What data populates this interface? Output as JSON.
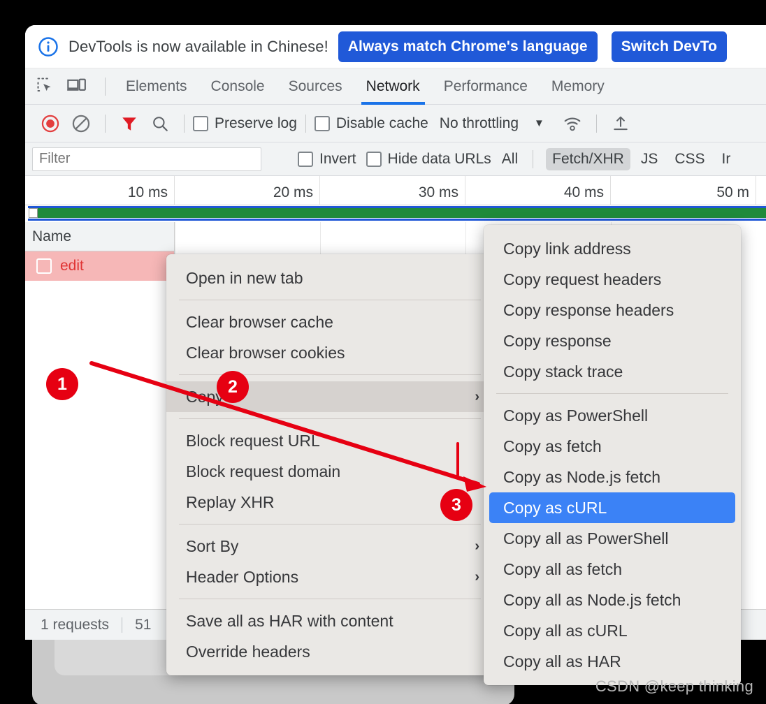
{
  "banner": {
    "icon": "info-circle-icon",
    "message": "DevTools is now available in Chinese!",
    "primary_button": "Always match Chrome's language",
    "secondary_button": "Switch DevTo"
  },
  "tabs": {
    "inspect_icon": "inspect-element-icon",
    "device_icon": "device-toolbar-icon",
    "items": [
      {
        "label": "Elements",
        "active": false
      },
      {
        "label": "Console",
        "active": false
      },
      {
        "label": "Sources",
        "active": false
      },
      {
        "label": "Network",
        "active": true
      },
      {
        "label": "Performance",
        "active": false
      },
      {
        "label": "Memory",
        "active": false
      }
    ]
  },
  "toolbar": {
    "record_icon": "record-icon",
    "clear_icon": "clear-icon",
    "filter_icon": "filter-icon",
    "search_icon": "search-icon",
    "preserve_log": "Preserve log",
    "disable_cache": "Disable cache",
    "throttling": "No throttling",
    "throttle_caret": "chevron-down-icon",
    "wifi_icon": "network-conditions-icon",
    "import_icon": "import-har-icon"
  },
  "filter": {
    "placeholder": "Filter",
    "value": "",
    "invert": "Invert",
    "hide_data_urls": "Hide data URLs",
    "types": [
      {
        "label": "All",
        "selected": false
      },
      {
        "label": "Fetch/XHR",
        "selected": true
      },
      {
        "label": "JS",
        "selected": false
      },
      {
        "label": "CSS",
        "selected": false
      },
      {
        "label": "Ir",
        "selected": false
      }
    ]
  },
  "timeline": {
    "ticks": [
      "10 ms",
      "20 ms",
      "30 ms",
      "40 ms",
      "50 m"
    ]
  },
  "requests": {
    "column_header": "Name",
    "rows": [
      {
        "name": "edit",
        "error": true
      }
    ]
  },
  "status": {
    "requests": "1 requests",
    "transferred": "51"
  },
  "context_menu": {
    "items": [
      {
        "label": "Open in new tab",
        "type": "item"
      },
      {
        "type": "separator"
      },
      {
        "label": "Clear browser cache",
        "type": "item"
      },
      {
        "label": "Clear browser cookies",
        "type": "item"
      },
      {
        "type": "separator"
      },
      {
        "label": "Copy",
        "type": "submenu",
        "hover": true,
        "arrow": "›"
      },
      {
        "type": "separator"
      },
      {
        "label": "Block request URL",
        "type": "item"
      },
      {
        "label": "Block request domain",
        "type": "item"
      },
      {
        "label": "Replay XHR",
        "type": "item"
      },
      {
        "type": "separator"
      },
      {
        "label": "Sort By",
        "type": "submenu",
        "arrow": "›"
      },
      {
        "label": "Header Options",
        "type": "submenu",
        "arrow": "›"
      },
      {
        "type": "separator"
      },
      {
        "label": "Save all as HAR with content",
        "type": "item"
      },
      {
        "label": "Override headers",
        "type": "item"
      }
    ]
  },
  "copy_submenu": {
    "items": [
      {
        "label": "Copy link address",
        "type": "item"
      },
      {
        "label": "Copy request headers",
        "type": "item"
      },
      {
        "label": "Copy response headers",
        "type": "item"
      },
      {
        "label": "Copy response",
        "type": "item"
      },
      {
        "label": "Copy stack trace",
        "type": "item"
      },
      {
        "type": "separator"
      },
      {
        "label": "Copy as PowerShell",
        "type": "item"
      },
      {
        "label": "Copy as fetch",
        "type": "item"
      },
      {
        "label": "Copy as Node.js fetch",
        "type": "item"
      },
      {
        "label": "Copy as cURL",
        "type": "item",
        "selected": true
      },
      {
        "label": "Copy all as PowerShell",
        "type": "item"
      },
      {
        "label": "Copy all as fetch",
        "type": "item"
      },
      {
        "label": "Copy all as Node.js fetch",
        "type": "item"
      },
      {
        "label": "Copy all as cURL",
        "type": "item"
      },
      {
        "label": "Copy all as HAR",
        "type": "item"
      }
    ]
  },
  "annotations": {
    "badges": [
      "1",
      "2",
      "3"
    ],
    "color": "#e60012"
  },
  "watermark": "CSDN @keep   thinking",
  "colors": {
    "accent_blue": "#1a73e8",
    "button_blue": "#2059d8",
    "selection_blue": "#3b82f6",
    "error_row": "#f6b7b7",
    "error_text": "#e03434",
    "overview_green": "#1f8a3b",
    "annotation_red": "#e60012"
  }
}
